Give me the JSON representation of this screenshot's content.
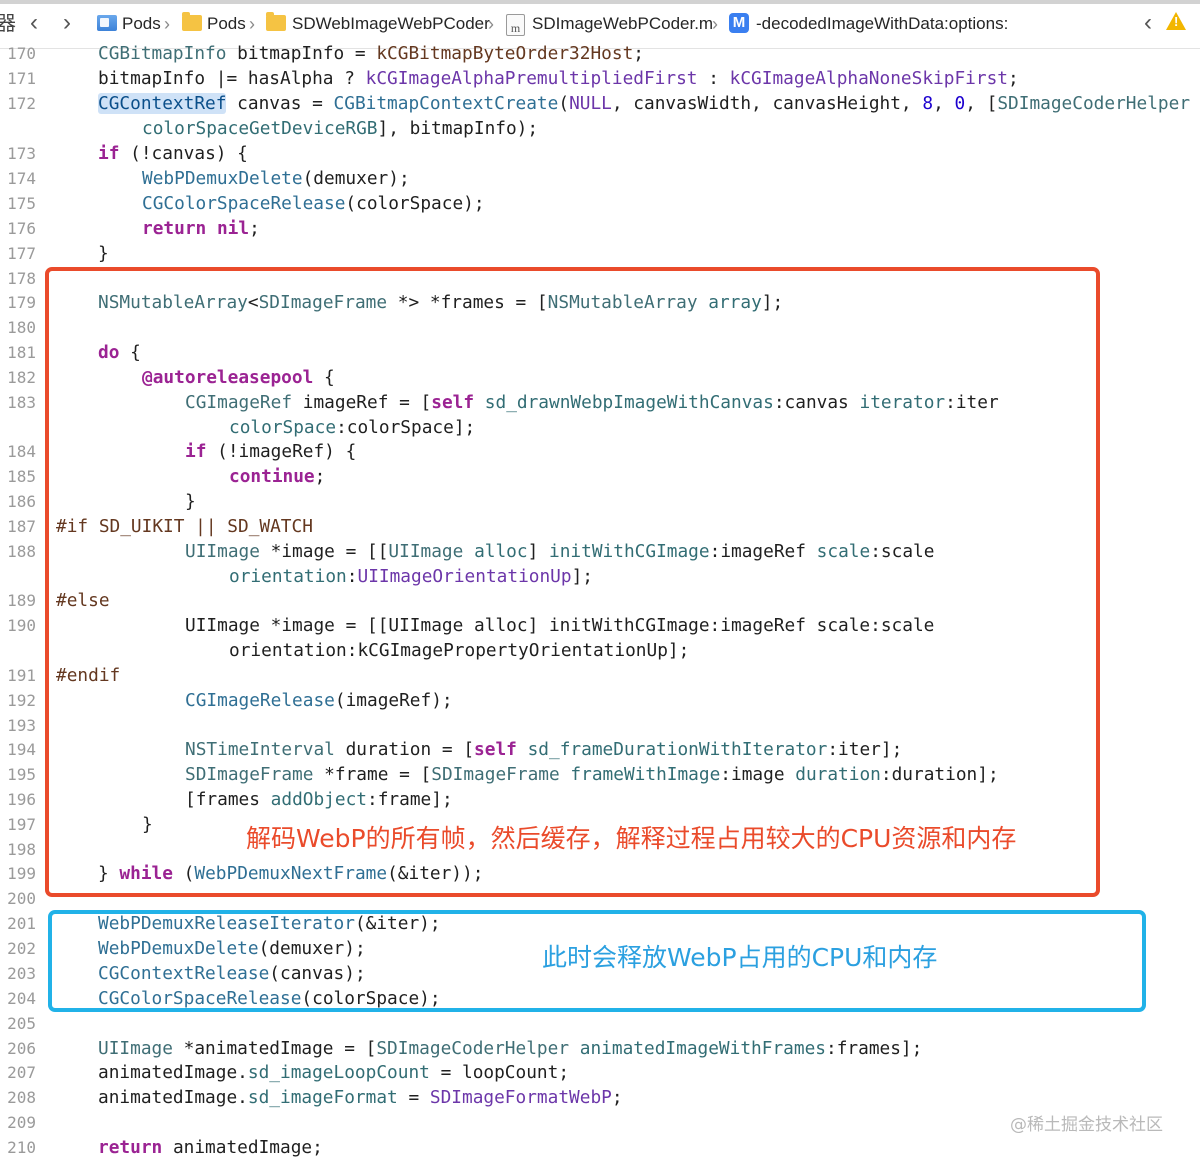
{
  "breadcrumbs": {
    "grid_glyph": "器",
    "back": "‹",
    "forward": "›",
    "items": [
      {
        "label": "Pods"
      },
      {
        "label": "Pods"
      },
      {
        "label": "SDWebImageWebPCoder"
      },
      {
        "label": "SDImageWebPCoder.m"
      },
      {
        "label": "-decodedImageWithData:options:"
      }
    ],
    "file_icon_letter": "m",
    "method_badge": "M",
    "issue_prev": "‹",
    "warning_mark": "!"
  },
  "line_numbers": [
    "170",
    "171",
    "172",
    "",
    "173",
    "174",
    "175",
    "176",
    "177",
    "178",
    "179",
    "180",
    "181",
    "182",
    "183",
    "",
    "184",
    "185",
    "186",
    "187",
    "188",
    "",
    "189",
    "190",
    "",
    "191",
    "192",
    "193",
    "194",
    "195",
    "196",
    "197",
    "198",
    "199",
    "200",
    "201",
    "202",
    "203",
    "204",
    "205",
    "206",
    "207",
    "208",
    "209",
    "210"
  ],
  "code": {
    "l170": [
      "CGBitmapInfo",
      " bitmapInfo = ",
      "kCGBitmapByteOrder32Host",
      ";"
    ],
    "l171": [
      "bitmapInfo |= hasAlpha ? ",
      "kCGImageAlphaPremultipliedFirst",
      " : ",
      "kCGImageAlphaNoneSkipFirst",
      ";"
    ],
    "l172": [
      "CGContextRef",
      " canvas = ",
      "CGBitmapContextCreate",
      "(",
      "NULL",
      ", canvasWidth, canvasHeight, ",
      "8",
      ", ",
      "0",
      ", [",
      "SDImageCoderHelper"
    ],
    "l172b": [
      "colorSpaceGetDeviceRGB",
      "], bitmapInfo);"
    ],
    "l173": [
      "if",
      " (!canvas) {"
    ],
    "l174": [
      "WebPDemuxDelete",
      "(demuxer);"
    ],
    "l175": [
      "CGColorSpaceRelease",
      "(colorSpace);"
    ],
    "l176": [
      "return",
      " ",
      "nil",
      ";"
    ],
    "l177": [
      "}"
    ],
    "l179": [
      "NSMutableArray",
      "<",
      "SDImageFrame",
      " *> *frames = [",
      "NSMutableArray",
      " ",
      "array",
      "];"
    ],
    "l181": [
      "do",
      " {"
    ],
    "l182": [
      "@autoreleasepool",
      " {"
    ],
    "l183": [
      "CGImageRef",
      " imageRef = [",
      "self",
      " ",
      "sd_drawnWebpImageWithCanvas",
      ":canvas ",
      "iterator",
      ":iter"
    ],
    "l183b": [
      "colorSpace",
      ":colorSpace];"
    ],
    "l184": [
      "if",
      " (!imageRef) {"
    ],
    "l185": [
      "continue",
      ";"
    ],
    "l186": [
      "}"
    ],
    "l187": [
      "#if SD_UIKIT || SD_WATCH"
    ],
    "l188": [
      "UIImage",
      " *image = [[",
      "UIImage",
      " ",
      "alloc",
      "] ",
      "initWithCGImage",
      ":imageRef ",
      "scale",
      ":scale"
    ],
    "l188b": [
      "orientation",
      ":",
      "UIImageOrientationUp",
      "];"
    ],
    "l189": [
      "#else"
    ],
    "l190": [
      "UIImage *image = [[UIImage alloc] initWithCGImage:imageRef scale:scale"
    ],
    "l190b": [
      "orientation:kCGImagePropertyOrientationUp];"
    ],
    "l191": [
      "#endif"
    ],
    "l192": [
      "CGImageRelease",
      "(imageRef);"
    ],
    "l194": [
      "NSTimeInterval",
      " duration = [",
      "self",
      " ",
      "sd_frameDurationWithIterator",
      ":iter];"
    ],
    "l195": [
      "SDImageFrame",
      " *frame = [",
      "SDImageFrame",
      " ",
      "frameWithImage",
      ":image ",
      "duration",
      ":duration];"
    ],
    "l196": [
      "[frames ",
      "addObject",
      ":frame];"
    ],
    "l197": [
      "}"
    ],
    "l199": [
      "} ",
      "while",
      " (",
      "WebPDemuxNextFrame",
      "(&iter));"
    ],
    "l201": [
      "WebPDemuxReleaseIterator",
      "(&iter);"
    ],
    "l202": [
      "WebPDemuxDelete",
      "(demuxer);"
    ],
    "l203": [
      "CGContextRelease",
      "(canvas);"
    ],
    "l204": [
      "CGColorSpaceRelease",
      "(colorSpace);"
    ],
    "l206": [
      "UIImage",
      " *animatedImage = [",
      "SDImageCoderHelper",
      " ",
      "animatedImageWithFrames",
      ":frames];"
    ],
    "l207": [
      "animatedImage.",
      "sd_imageLoopCount",
      " = loopCount;"
    ],
    "l208": [
      "animatedImage.",
      "sd_imageFormat",
      " = ",
      "SDImageFormatWebP",
      ";"
    ],
    "l210": [
      "return",
      " animatedImage;"
    ]
  },
  "annotations": {
    "red_note": "解码WebP的所有帧，然后缓存，解释过程占用较大的CPU资源和内存",
    "blue_note": "此时会释放WebP占用的CPU和内存",
    "red_color": "#ea4b2b",
    "blue_color": "#21b2e8"
  },
  "watermark": "@稀土掘金技术社区"
}
